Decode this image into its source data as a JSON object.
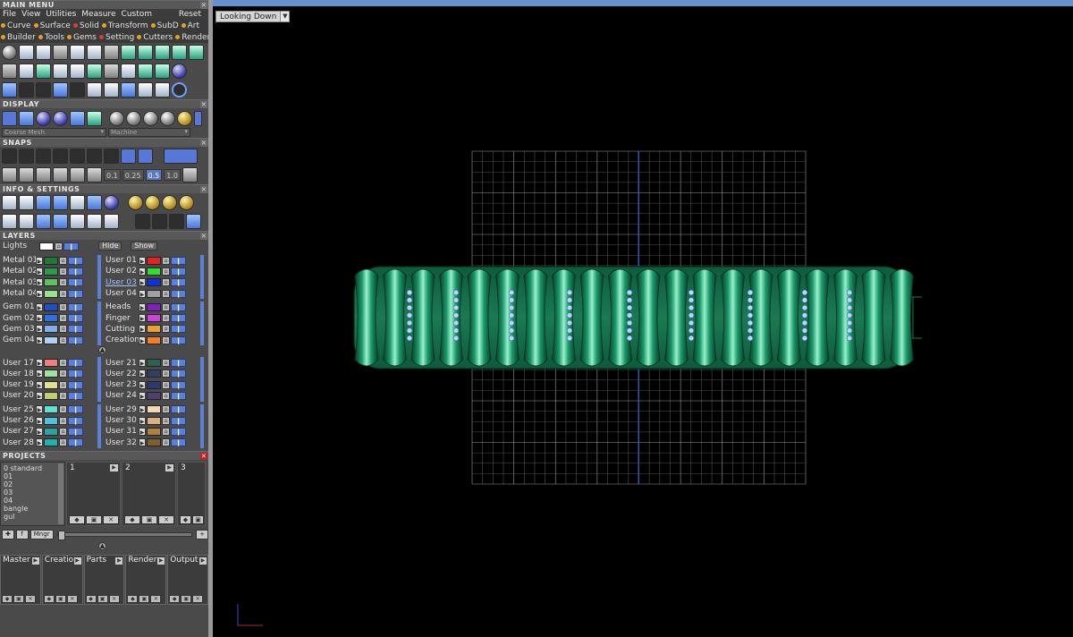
{
  "main_menu": {
    "title": "MAIN MENU",
    "menu": [
      "File",
      "View",
      "Utilities",
      "Measure",
      "Custom"
    ],
    "reset": "Reset",
    "row1": [
      {
        "label": "Curve",
        "color": "#e6a02a"
      },
      {
        "label": "Surface",
        "color": "#e6a02a"
      },
      {
        "label": "Solid",
        "color": "#d8402a"
      },
      {
        "label": "Transform",
        "color": "#e6a02a"
      },
      {
        "label": "SubD",
        "color": "#e6a02a"
      },
      {
        "label": "Art",
        "color": "#e6a02a"
      }
    ],
    "row2": [
      {
        "label": "Builder",
        "color": "#e6a02a"
      },
      {
        "label": "Tools",
        "color": "#e6a02a"
      },
      {
        "label": "Gems",
        "color": "#e6a02a"
      },
      {
        "label": "Setting",
        "color": "#d8402a"
      },
      {
        "label": "Cutters",
        "color": "#e6a02a"
      },
      {
        "label": "Render",
        "color": "#e6a02a"
      }
    ]
  },
  "display": {
    "title": "DISPLAY",
    "mesh_select": "Coarse Mesh",
    "material_select": "Machine"
  },
  "snaps": {
    "title": "SNAPS",
    "values": [
      "0.1",
      "0.25",
      "0.5",
      "1.0"
    ],
    "active_value": "0.5"
  },
  "info_settings": {
    "title": "INFO & SETTINGS"
  },
  "layers": {
    "title": "LAYERS",
    "lights_label": "Lights",
    "hide_label": "Hide",
    "show_label": "Show",
    "groups": [
      {
        "left": [
          {
            "name": "Metal 01",
            "color": "#1f7a3a"
          },
          {
            "name": "Metal 02",
            "color": "#2c9a4a"
          },
          {
            "name": "Metal 03",
            "color": "#60c060"
          },
          {
            "name": "Metal 04",
            "color": "#9ae090"
          }
        ],
        "right": [
          {
            "name": "User 01",
            "color": "#e82020"
          },
          {
            "name": "User 02",
            "color": "#30e030"
          },
          {
            "name": "User 03",
            "color": "#1030e0",
            "highlighted": true
          },
          {
            "name": "User 04",
            "color": "#a0a0a0"
          }
        ]
      },
      {
        "left": [
          {
            "name": "Gem 01",
            "color": "#2050c0"
          },
          {
            "name": "Gem 02",
            "color": "#3070e0"
          },
          {
            "name": "Gem 03",
            "color": "#80b0f0"
          },
          {
            "name": "Gem 04",
            "color": "#b0d0f8"
          }
        ],
        "right": [
          {
            "name": "Heads",
            "color": "#8020c0"
          },
          {
            "name": "Finger",
            "color": "#d040e0"
          },
          {
            "name": "Cutting",
            "color": "#f0a030"
          },
          {
            "name": "Creation",
            "color": "#f08020"
          }
        ]
      },
      {
        "left": [
          {
            "name": "User 17",
            "color": "#f08080"
          },
          {
            "name": "User 18",
            "color": "#a0e0a0"
          },
          {
            "name": "User 19",
            "color": "#e0e090"
          },
          {
            "name": "User 20",
            "color": "#c0d070"
          }
        ],
        "right": [
          {
            "name": "User 21",
            "color": "#306050"
          },
          {
            "name": "User 22",
            "color": "#304060"
          },
          {
            "name": "User 23",
            "color": "#303870"
          },
          {
            "name": "User 24",
            "color": "#504070"
          }
        ]
      },
      {
        "left": [
          {
            "name": "User 25",
            "color": "#60e0d0"
          },
          {
            "name": "User 26",
            "color": "#50c0e0"
          },
          {
            "name": "User 27",
            "color": "#30a0a0"
          },
          {
            "name": "User 28",
            "color": "#20b0b0"
          }
        ],
        "right": [
          {
            "name": "User 29",
            "color": "#f0d8b0"
          },
          {
            "name": "User 30",
            "color": "#d8b080"
          },
          {
            "name": "User 31",
            "color": "#b08040"
          },
          {
            "name": "User 32",
            "color": "#806030"
          }
        ]
      }
    ]
  },
  "projects": {
    "title": "PROJECTS",
    "list": [
      "0 standard",
      "01",
      "02",
      "03",
      "04",
      "bangle",
      "gul"
    ],
    "slots": [
      "1",
      "2",
      "3"
    ],
    "mngr_label": "Mngr"
  },
  "bottom_tabs": [
    "Master",
    "Creation",
    "Parts",
    "Render",
    "Output"
  ],
  "viewport": {
    "view_label": "Looking Down",
    "model_color": "#1a8a5a",
    "gem_color": "#b8d8ff",
    "grid_color": "#8a8a8a"
  }
}
